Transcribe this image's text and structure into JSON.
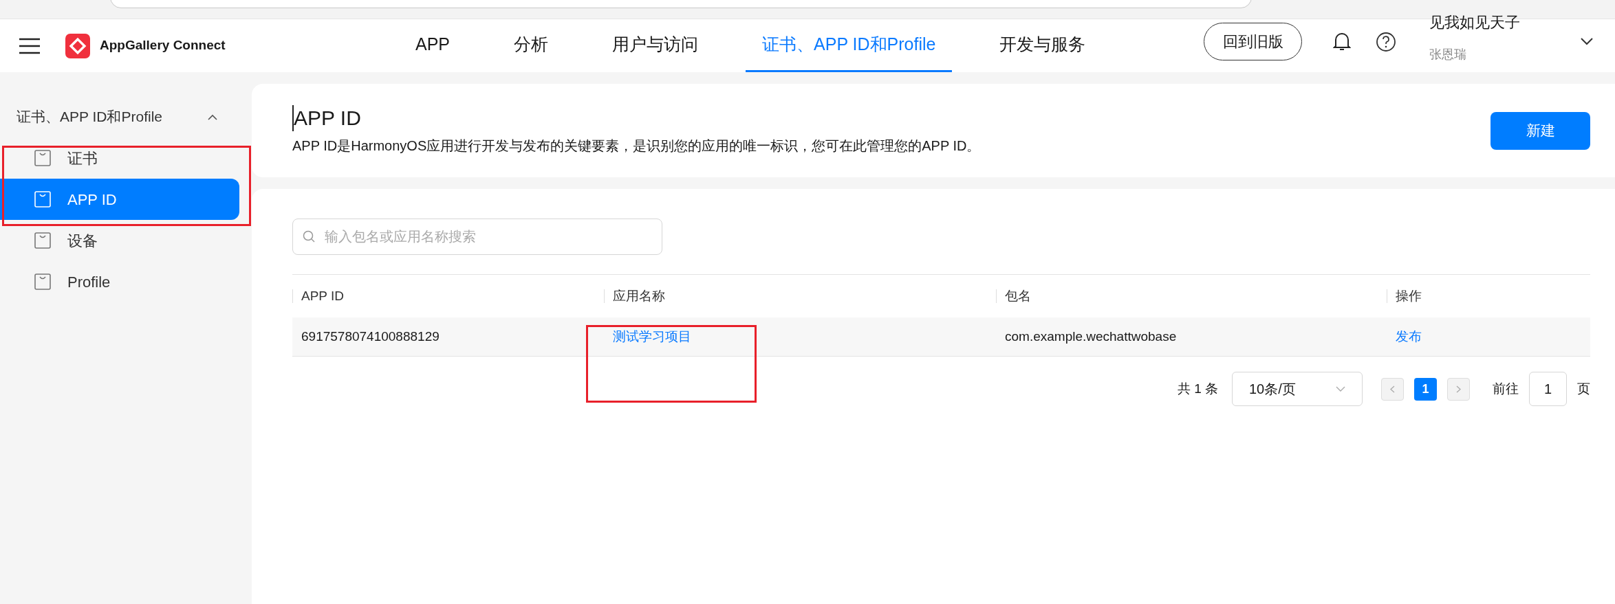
{
  "header": {
    "brand": "AppGallery Connect",
    "nav": [
      {
        "label": "APP",
        "selected": false
      },
      {
        "label": "分析",
        "selected": false
      },
      {
        "label": "用户与访问",
        "selected": false
      },
      {
        "label": "证书、APP ID和Profile",
        "selected": true
      },
      {
        "label": "开发与服务",
        "selected": false
      }
    ],
    "old_version_button": "回到旧版",
    "user": {
      "name": "见我如见天子",
      "account": "张恩瑞"
    }
  },
  "sidebar": {
    "group": {
      "label": "证书、APP ID和Profile",
      "expanded": true
    },
    "items": [
      {
        "label": "证书",
        "selected": false
      },
      {
        "label": "APP ID",
        "selected": true
      },
      {
        "label": "设备",
        "selected": false
      },
      {
        "label": "Profile",
        "selected": false
      }
    ]
  },
  "page": {
    "title": "APP ID",
    "description": "APP ID是HarmonyOS应用进行开发与发布的关键要素，是识别您的应用的唯一标识，您可在此管理您的APP ID。",
    "new_button": "新建"
  },
  "search": {
    "placeholder": "输入包名或应用名称搜索"
  },
  "table": {
    "columns": [
      "APP ID",
      "应用名称",
      "包名",
      "操作"
    ],
    "rows": [
      {
        "app_id": "6917578074100888129",
        "app_name": "测试学习项目",
        "package": "com.example.wechattwobase",
        "action": "发布"
      }
    ]
  },
  "pagination": {
    "total": "共 1 条",
    "page_size": "10条/页",
    "pages": [
      {
        "label": "1",
        "selected": true
      }
    ],
    "goto_label": "前往",
    "goto_value": "1",
    "goto_suffix": "页"
  }
}
